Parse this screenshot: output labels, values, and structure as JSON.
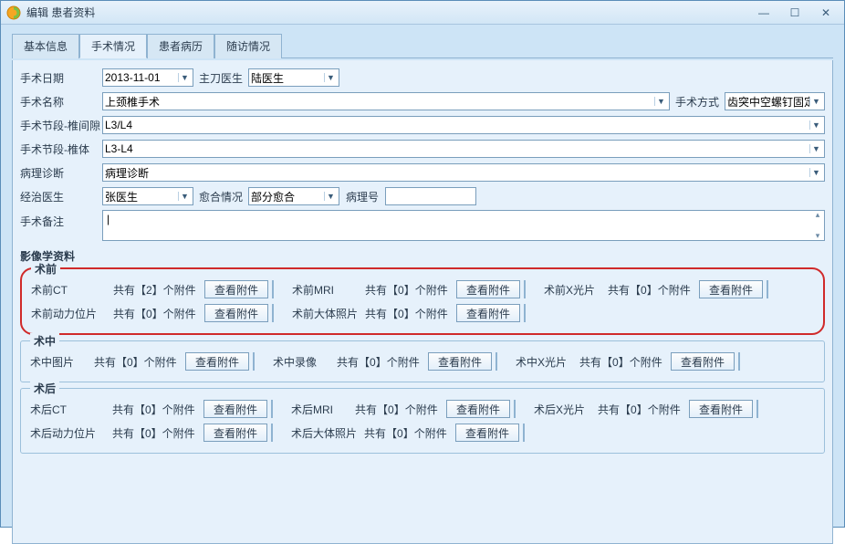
{
  "window": {
    "title": "编辑 患者资料"
  },
  "tabs": {
    "t0": "基本信息",
    "t1": "手术情况",
    "t2": "患者病历",
    "t3": "随访情况"
  },
  "labels": {
    "surgeryDate": "手术日期",
    "surgeon": "主刀医生",
    "surgeryName": "手术名称",
    "method": "手术方式",
    "segGap": "手术节段-椎间隙",
    "segBody": "手术节段-椎体",
    "pathDiag": "病理诊断",
    "attending": "经治医生",
    "fusion": "愈合情况",
    "pathNo": "病理号",
    "remark": "手术备注",
    "imaging": "影像学资料",
    "pre": "术前",
    "intra": "术中",
    "post": "术后",
    "preCT": "术前CT",
    "preMRI": "术前MRI",
    "preXray": "术前X光片",
    "preDyn": "术前动力位片",
    "preGross": "术前大体照片",
    "intraPic": "术中图片",
    "intraVideo": "术中录像",
    "intraXray": "术中X光片",
    "postCT": "术后CT",
    "postMRI": "术后MRI",
    "postXray": "术后X光片",
    "postDyn": "术后动力位片",
    "postGross": "术后大体照片",
    "viewAtt": "查看附件"
  },
  "fields": {
    "surgeryDate": "2013-11-01",
    "surgeon": "陆医生",
    "surgeryName": "上颈椎手术",
    "method": "齿突中空螺钉固定",
    "segGap": "L3/L4",
    "segBody": "L3-L4",
    "pathDiag": "病理诊断",
    "attending": "张医生",
    "fusion": "部分愈合",
    "pathNo": "",
    "remark": ""
  },
  "counts": {
    "preCT": "共有【2】个附件",
    "preMRI": "共有【0】个附件",
    "preXray": "共有【0】个附件",
    "preDyn": "共有【0】个附件",
    "preGross": "共有【0】个附件",
    "intraPic": "共有【0】个附件",
    "intraVideo": "共有【0】个附件",
    "intraXray": "共有【0】个附件",
    "postCT": "共有【0】个附件",
    "postMRI": "共有【0】个附件",
    "postXray": "共有【0】个附件",
    "postDyn": "共有【0】个附件",
    "postGross": "共有【0】个附件"
  }
}
